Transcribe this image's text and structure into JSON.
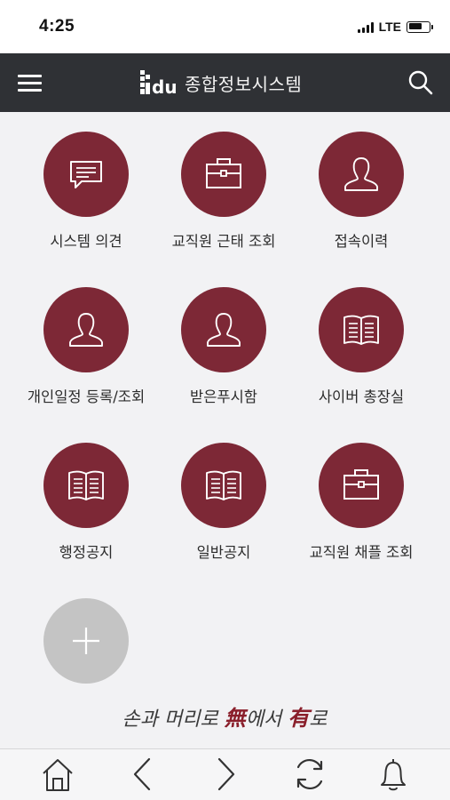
{
  "status_bar": {
    "time": "4:25",
    "network": "LTE"
  },
  "header": {
    "logo_text": "du",
    "title": "종합정보시스템"
  },
  "tiles": [
    {
      "label": "시스템 의견",
      "icon": "chat-icon"
    },
    {
      "label": "교직원 근태 조회",
      "icon": "briefcase-icon"
    },
    {
      "label": "접속이력",
      "icon": "person-icon"
    },
    {
      "label": "개인일정 등록/조회",
      "icon": "person-icon"
    },
    {
      "label": "받은푸시함",
      "icon": "person-icon"
    },
    {
      "label": "사이버 총장실",
      "icon": "book-icon"
    },
    {
      "label": "행정공지",
      "icon": "book-icon"
    },
    {
      "label": "일반공지",
      "icon": "book-icon"
    },
    {
      "label": "교직원 채플 조회",
      "icon": "briefcase-icon"
    },
    {
      "label": "",
      "icon": "plus-icon"
    }
  ],
  "slogan": {
    "part1": "손과 머리로 ",
    "char1": "無",
    "part2": "에서 ",
    "char2": "有",
    "part3": "로"
  },
  "bottom_nav": [
    "home-icon",
    "back-icon",
    "forward-icon",
    "refresh-icon",
    "bell-icon"
  ],
  "colors": {
    "tile": "#7d2836",
    "header": "#2f3135",
    "add_tile": "#c4c4c4",
    "slogan_accent": "#8a1f2b"
  }
}
